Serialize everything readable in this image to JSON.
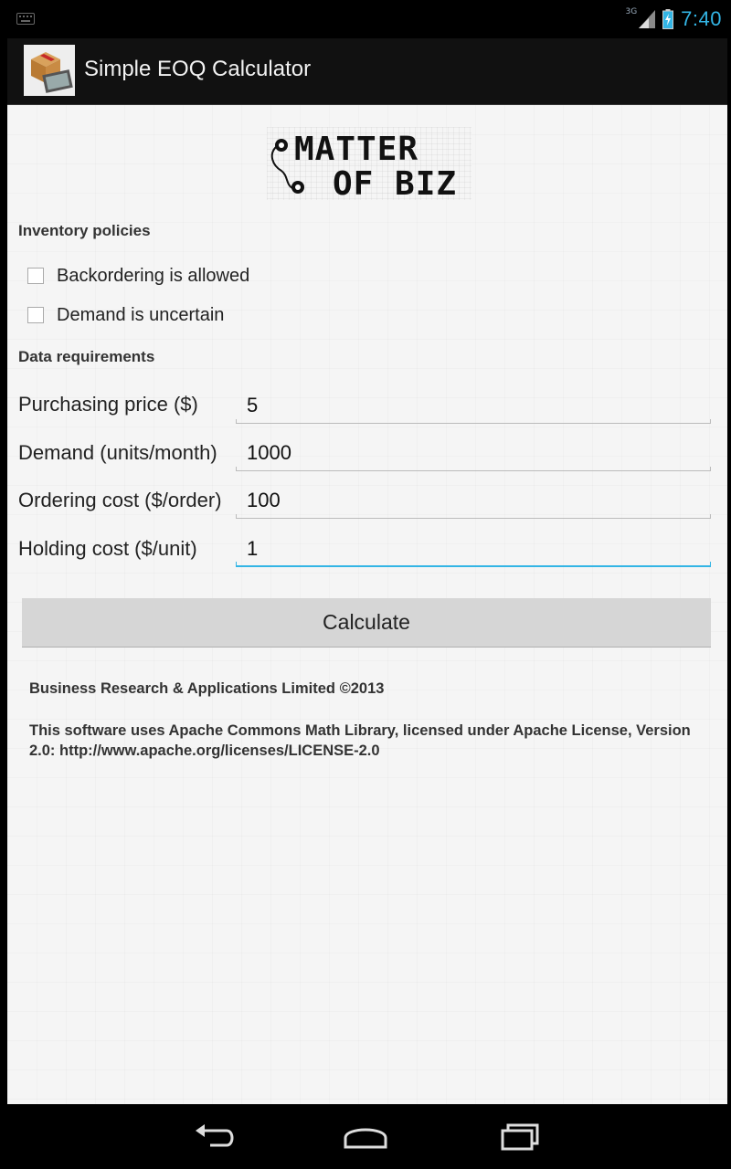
{
  "status_bar": {
    "network": "3G",
    "time": "7:40"
  },
  "action_bar": {
    "title": "Simple EOQ Calculator"
  },
  "logo": {
    "line1": "MATTER",
    "line2": "OF BIZ"
  },
  "inventory": {
    "title": "Inventory policies",
    "options": [
      {
        "label": "Backordering is allowed",
        "checked": false
      },
      {
        "label": "Demand is uncertain",
        "checked": false
      }
    ]
  },
  "data_requirements": {
    "title": "Data requirements",
    "fields": [
      {
        "label": "Purchasing price ($)",
        "value": "5"
      },
      {
        "label": "Demand (units/month)",
        "value": "1000"
      },
      {
        "label": "Ordering cost ($/order)",
        "value": "100"
      },
      {
        "label": "Holding cost ($/unit)",
        "value": "1"
      }
    ]
  },
  "calculate_label": "Calculate",
  "footer": {
    "copyright": "Business Research & Applications Limited ©2013",
    "license": "This software uses Apache Commons Math Library, licensed under Apache License, Version 2.0: http://www.apache.org/licenses/LICENSE-2.0"
  },
  "icons": {
    "status_left": "keyboard-icon",
    "signal": "signal-icon",
    "battery": "battery-icon",
    "nav_back": "back-icon",
    "nav_home": "home-icon",
    "nav_recents": "recents-icon"
  },
  "colors": {
    "accent": "#33b5e5",
    "content_bg": "#f5f5f5",
    "button_bg": "#d6d6d6"
  }
}
